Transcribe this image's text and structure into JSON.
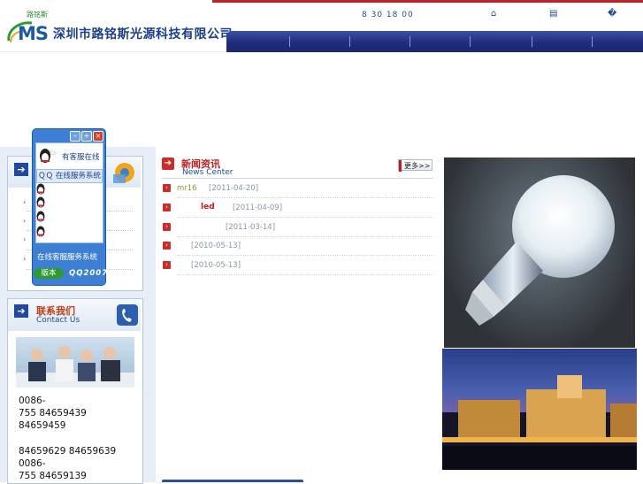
{
  "header": {
    "logo_text": "MS",
    "logo_tagline": "路铭斯",
    "company_name": "深圳市路铭斯光源科技有限公司",
    "business_hours": "8 30   18 00",
    "icons": [
      "home-icon",
      "sitemap-icon",
      "favorite-icon"
    ],
    "icon_glyphs": [
      "⌂",
      "▤",
      "�"
    ],
    "nav_items": [
      "",
      "",
      "",
      "",
      "",
      ""
    ]
  },
  "qq_widget": {
    "greeting": "有客服在线",
    "system_label": "ＱＱ 在线服务系统",
    "footer_label": "在线客服服务系统",
    "version_label": "版本",
    "brand_label": "QQ2007",
    "controls": [
      "minimize-icon",
      "maximize-icon",
      "close-icon"
    ]
  },
  "left_list": {
    "bullet": "›"
  },
  "contact": {
    "title": "联系我们",
    "subtitle": "Contact Us",
    "lines": [
      "0086-",
      "755 84659439",
      "84659459",
      "",
      "84659629 84659639",
      "0086-",
      "755 84659139"
    ]
  },
  "news": {
    "title": "新闻资讯",
    "subtitle": "News Center",
    "more_label": "更多>>",
    "items": [
      {
        "title": "mr16",
        "date": "[2011-04-20]"
      },
      {
        "title": "led",
        "date": "[2011-04-09]"
      },
      {
        "title": "",
        "date": "[2011-03-14]"
      },
      {
        "title": "",
        "date": "[2010-05-13]"
      },
      {
        "title": "",
        "date": "[2010-05-13]"
      }
    ]
  },
  "colors": {
    "brand_blue": "#1f2d7c",
    "accent_red": "#c4202a",
    "sidebar_bg": "#e8eef7"
  }
}
